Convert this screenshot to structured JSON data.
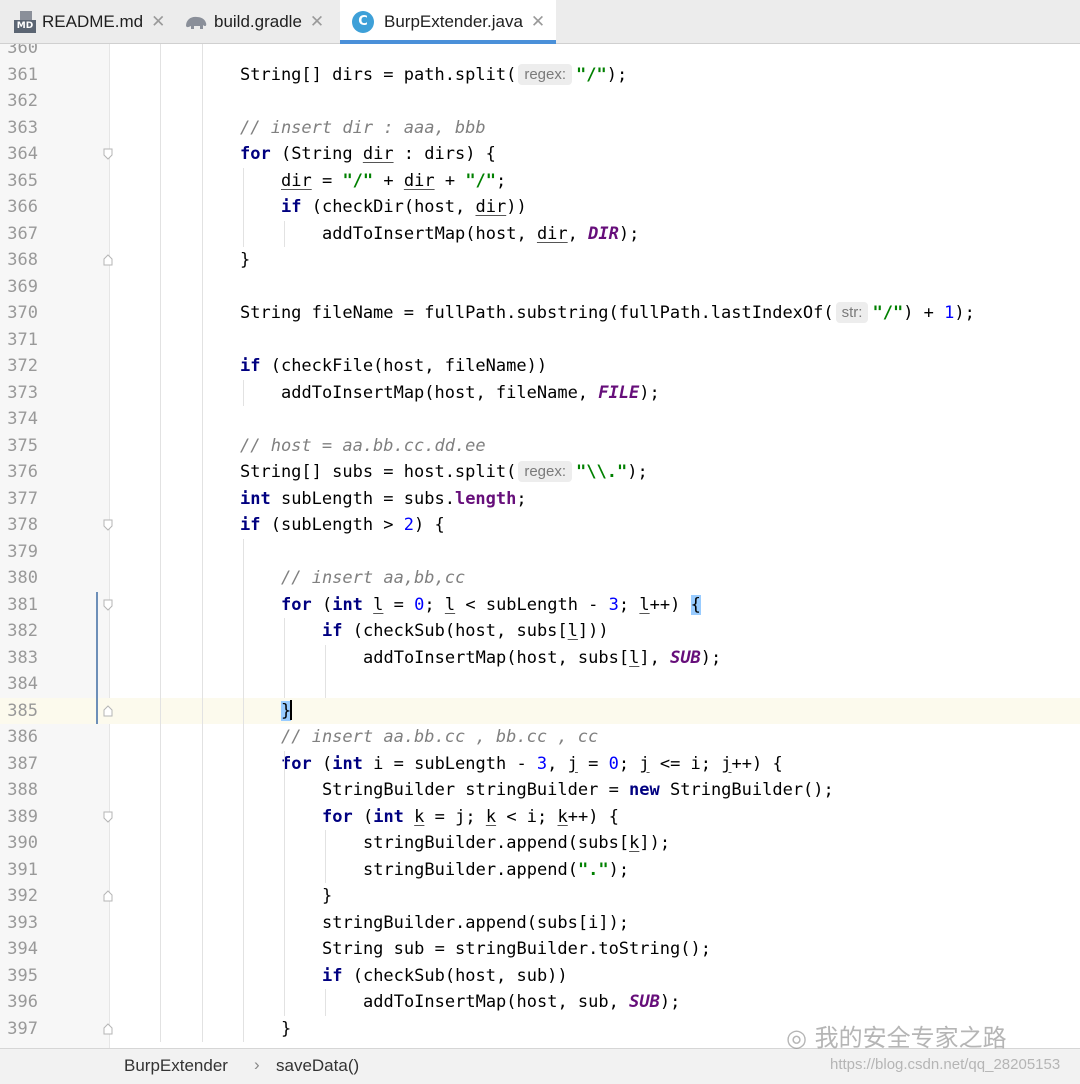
{
  "tabs": [
    {
      "label": "README.md",
      "icon": "markdown-file-icon",
      "icon_text": "MD",
      "active": false
    },
    {
      "label": "build.gradle",
      "icon": "gradle-elephant-icon",
      "active": false
    },
    {
      "label": "BurpExtender.java",
      "icon": "java-class-icon",
      "icon_text": "C",
      "active": true
    }
  ],
  "editor": {
    "lines": [
      {
        "n": "360",
        "indent": 0,
        "tokens": []
      },
      {
        "n": "361",
        "indent": 0,
        "tokens": [
          [
            "t",
            "String[] dirs = path.split("
          ],
          [
            "h",
            "regex:"
          ],
          [
            "s",
            "\"/\""
          ],
          [
            "t",
            ");"
          ]
        ]
      },
      {
        "n": "362",
        "indent": 0,
        "tokens": []
      },
      {
        "n": "363",
        "indent": 0,
        "tokens": [
          [
            "c",
            "// insert dir : aaa, bbb"
          ]
        ]
      },
      {
        "n": "364",
        "indent": 0,
        "fold": "open",
        "tokens": [
          [
            "k",
            "for"
          ],
          [
            "t",
            " (String "
          ],
          [
            "u",
            "dir"
          ],
          [
            "t",
            " : dirs) {"
          ]
        ]
      },
      {
        "n": "365",
        "indent": 1,
        "tokens": [
          [
            "u",
            "dir"
          ],
          [
            "t",
            " = "
          ],
          [
            "s",
            "\"/\""
          ],
          [
            "t",
            " + "
          ],
          [
            "u",
            "dir"
          ],
          [
            "t",
            " + "
          ],
          [
            "s",
            "\"/\""
          ],
          [
            "t",
            ";"
          ]
        ]
      },
      {
        "n": "366",
        "indent": 1,
        "tokens": [
          [
            "k",
            "if"
          ],
          [
            "t",
            " (checkDir(host, "
          ],
          [
            "u",
            "dir"
          ],
          [
            "t",
            "))"
          ]
        ]
      },
      {
        "n": "367",
        "indent": 2,
        "tokens": [
          [
            "t",
            "addToInsertMap(host, "
          ],
          [
            "u",
            "dir"
          ],
          [
            "t",
            ", "
          ],
          [
            "x",
            "DIR"
          ],
          [
            "t",
            ");"
          ]
        ]
      },
      {
        "n": "368",
        "indent": 0,
        "fold": "close",
        "tokens": [
          [
            "t",
            "}"
          ]
        ]
      },
      {
        "n": "369",
        "indent": 0,
        "tokens": []
      },
      {
        "n": "370",
        "indent": 0,
        "tokens": [
          [
            "t",
            "String fileName = fullPath.substring(fullPath.lastIndexOf("
          ],
          [
            "h",
            "str:"
          ],
          [
            "s",
            "\"/\""
          ],
          [
            "t",
            ") + "
          ],
          [
            "n",
            "1"
          ],
          [
            "t",
            ");"
          ]
        ]
      },
      {
        "n": "371",
        "indent": 0,
        "tokens": []
      },
      {
        "n": "372",
        "indent": 0,
        "tokens": [
          [
            "k",
            "if"
          ],
          [
            "t",
            " (checkFile(host, fileName))"
          ]
        ]
      },
      {
        "n": "373",
        "indent": 1,
        "tokens": [
          [
            "t",
            "addToInsertMap(host, fileName, "
          ],
          [
            "x",
            "FILE"
          ],
          [
            "t",
            ");"
          ]
        ]
      },
      {
        "n": "374",
        "indent": 0,
        "tokens": []
      },
      {
        "n": "375",
        "indent": 0,
        "tokens": [
          [
            "c",
            "// host = aa.bb.cc.dd.ee"
          ]
        ]
      },
      {
        "n": "376",
        "indent": 0,
        "tokens": [
          [
            "t",
            "String[] subs = host.split("
          ],
          [
            "h",
            "regex:"
          ],
          [
            "s",
            "\"\\\\.\""
          ],
          [
            "t",
            ");"
          ]
        ]
      },
      {
        "n": "377",
        "indent": 0,
        "tokens": [
          [
            "k",
            "int"
          ],
          [
            "t",
            " subLength = subs."
          ],
          [
            "f",
            "length"
          ],
          [
            "t",
            ";"
          ]
        ]
      },
      {
        "n": "378",
        "indent": 0,
        "fold": "open",
        "tokens": [
          [
            "k",
            "if"
          ],
          [
            "t",
            " (subLength > "
          ],
          [
            "n",
            "2"
          ],
          [
            "t",
            ") {"
          ]
        ]
      },
      {
        "n": "379",
        "indent": 0,
        "tokens": []
      },
      {
        "n": "380",
        "indent": 1,
        "tokens": [
          [
            "c",
            "// insert aa,bb,cc"
          ]
        ]
      },
      {
        "n": "381",
        "indent": 1,
        "fold": "open",
        "tokens": [
          [
            "k",
            "for"
          ],
          [
            "t",
            " ("
          ],
          [
            "k",
            "int"
          ],
          [
            "t",
            " "
          ],
          [
            "u",
            "l"
          ],
          [
            "t",
            " = "
          ],
          [
            "n",
            "0"
          ],
          [
            "t",
            "; "
          ],
          [
            "u",
            "l"
          ],
          [
            "t",
            " < subLength - "
          ],
          [
            "n",
            "3"
          ],
          [
            "t",
            "; "
          ],
          [
            "u",
            "l"
          ],
          [
            "t",
            "++) "
          ],
          [
            "b",
            "{"
          ]
        ]
      },
      {
        "n": "382",
        "indent": 2,
        "tokens": [
          [
            "k",
            "if"
          ],
          [
            "t",
            " (checkSub(host, subs["
          ],
          [
            "u",
            "l"
          ],
          [
            "t",
            "]))"
          ]
        ]
      },
      {
        "n": "383",
        "indent": 3,
        "tokens": [
          [
            "t",
            "addToInsertMap(host, subs["
          ],
          [
            "u",
            "l"
          ],
          [
            "t",
            "], "
          ],
          [
            "x",
            "SUB"
          ],
          [
            "t",
            ");"
          ]
        ]
      },
      {
        "n": "384",
        "indent": 0,
        "tokens": []
      },
      {
        "n": "385",
        "indent": 1,
        "fold": "close",
        "current": true,
        "tokens": [
          [
            "b",
            "}"
          ],
          [
            "caret",
            ""
          ]
        ]
      },
      {
        "n": "386",
        "indent": 1,
        "tokens": [
          [
            "c",
            "// insert aa.bb.cc , bb.cc , cc"
          ]
        ]
      },
      {
        "n": "387",
        "indent": 1,
        "tokens": [
          [
            "k",
            "for"
          ],
          [
            "t",
            " ("
          ],
          [
            "k",
            "int"
          ],
          [
            "t",
            " i = subLength - "
          ],
          [
            "n",
            "3"
          ],
          [
            "t",
            ", "
          ],
          [
            "u",
            "j"
          ],
          [
            "t",
            " = "
          ],
          [
            "n",
            "0"
          ],
          [
            "t",
            "; "
          ],
          [
            "u",
            "j"
          ],
          [
            "t",
            " <= i; "
          ],
          [
            "u",
            "j"
          ],
          [
            "t",
            "++) {"
          ]
        ]
      },
      {
        "n": "388",
        "indent": 2,
        "tokens": [
          [
            "t",
            "StringBuilder stringBuilder = "
          ],
          [
            "k",
            "new"
          ],
          [
            "t",
            " StringBuilder();"
          ]
        ]
      },
      {
        "n": "389",
        "indent": 2,
        "fold": "open",
        "tokens": [
          [
            "k",
            "for"
          ],
          [
            "t",
            " ("
          ],
          [
            "k",
            "int"
          ],
          [
            "t",
            " "
          ],
          [
            "u",
            "k"
          ],
          [
            "t",
            " = j; "
          ],
          [
            "u",
            "k"
          ],
          [
            "t",
            " < i; "
          ],
          [
            "u",
            "k"
          ],
          [
            "t",
            "++) {"
          ]
        ]
      },
      {
        "n": "390",
        "indent": 3,
        "tokens": [
          [
            "t",
            "stringBuilder.append(subs["
          ],
          [
            "u",
            "k"
          ],
          [
            "t",
            "]);"
          ]
        ]
      },
      {
        "n": "391",
        "indent": 3,
        "tokens": [
          [
            "t",
            "stringBuilder.append("
          ],
          [
            "s",
            "\".\""
          ],
          [
            "t",
            ");"
          ]
        ]
      },
      {
        "n": "392",
        "indent": 2,
        "fold": "close",
        "tokens": [
          [
            "t",
            "}"
          ]
        ]
      },
      {
        "n": "393",
        "indent": 2,
        "tokens": [
          [
            "t",
            "stringBuilder.append(subs[i]);"
          ]
        ]
      },
      {
        "n": "394",
        "indent": 2,
        "tokens": [
          [
            "t",
            "String sub = stringBuilder.toString();"
          ]
        ]
      },
      {
        "n": "395",
        "indent": 2,
        "tokens": [
          [
            "k",
            "if"
          ],
          [
            "t",
            " (checkSub(host, sub))"
          ]
        ]
      },
      {
        "n": "396",
        "indent": 3,
        "tokens": [
          [
            "t",
            "addToInsertMap(host, sub, "
          ],
          [
            "x",
            "SUB"
          ],
          [
            "t",
            ");"
          ]
        ]
      },
      {
        "n": "397",
        "indent": 1,
        "fold": "close",
        "tokens": [
          [
            "t",
            "}"
          ]
        ]
      }
    ]
  },
  "breadcrumb": {
    "file": "BurpExtender",
    "separator": "›",
    "method": "saveData()"
  },
  "watermark": {
    "text": "我的安全专家之路",
    "url": "https://blog.csdn.net/qq_28205153"
  },
  "colors": {
    "keyword": "#000080",
    "string": "#008000",
    "number": "#0000ff",
    "comment": "#808080",
    "constant": "#660e7a",
    "active_tab_underline": "#4a90d9",
    "current_line": "#fcfaed"
  }
}
